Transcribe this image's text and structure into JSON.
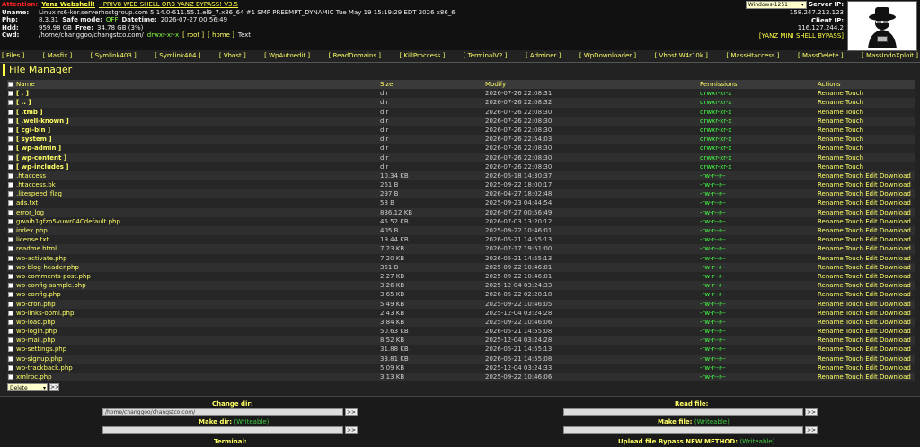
{
  "header": {
    "attention_label": "Attention:",
    "title": "Yanz Webshell!",
    "subtitle": "- PRIV8 WEB SHELL ORB YANZ BYPASS! V3.5",
    "uname_label": "Uname:",
    "uname_value": "Linux rs6-kor.serverhostgroup.com 5.14.0-611.55.1.el9_7.x86_64 #1 SMP PREEMPT_DYNAMIC Tue May 19 15:19:29 EDT 2026 x86_6",
    "php_label": "Php:",
    "php_version": "8.3.31",
    "safe_mode_label": "Safe mode:",
    "safe_mode_value": "OFF",
    "datetime_label": "Datetime:",
    "datetime_value": "2026-07-27 00:56:49",
    "hdd_label": "Hdd:",
    "hdd_total": "959.98 GB",
    "hdd_free_label": "Free:",
    "hdd_free": "34.78 GB (3%)",
    "cwd_label": "Cwd:",
    "cwd_path": "/home/changgoo/changstco.com/",
    "cwd_perm": "drwxr-xr-x",
    "cwd_root": "[ root ]",
    "cwd_home": "[ home ]",
    "cwd_text": "Text",
    "os_select": "Windows-1251",
    "server_ip_label": "Server IP:",
    "server_ip": "158.247.212.123",
    "client_ip_label": "Client IP:",
    "client_ip": "116.127.244.2",
    "bypass_label": "[YANZ MINI SHELL BYPASS]"
  },
  "menu": [
    "[ Files ]",
    "[ Masfix ]",
    "[ Symlink403 ]",
    "[ Symlink404 ]",
    "[ Vhost ]",
    "[ WpAutoedit ]",
    "[ ReadDomains ]",
    "[ KillProccess ]",
    "[ TerminalV2 ]",
    "[ Adminer ]",
    "[ WpDownloader ]",
    "[ Vhost W4r10k ]",
    "[ MassHtaccess ]",
    "[ MassDelete ]",
    "[ MassIndoXploit ]"
  ],
  "file_manager": {
    "title": "File Manager",
    "columns": {
      "name": "Name",
      "size": "Size",
      "modify": "Modify",
      "permissions": "Permissions",
      "actions": "Actions"
    },
    "rows": [
      {
        "name": "[ . ]",
        "size": "dir",
        "modify": "2026-07-26 22:08:31",
        "perm": "drwxr-xr-x",
        "actions": "Rename Touch",
        "dir": true
      },
      {
        "name": "[ .. ]",
        "size": "dir",
        "modify": "2026-07-26 22:08:32",
        "perm": "drwxr-xr-x",
        "actions": "Rename Touch",
        "dir": true
      },
      {
        "name": "[ .tmb ]",
        "size": "dir",
        "modify": "2026-07-26 22:08:30",
        "perm": "drwxr-xr-x",
        "actions": "Rename Touch",
        "dir": true
      },
      {
        "name": "[ .well-known ]",
        "size": "dir",
        "modify": "2026-07-26 22:08:30",
        "perm": "drwxr-xr-x",
        "actions": "Rename Touch",
        "dir": true
      },
      {
        "name": "[ cgi-bin ]",
        "size": "dir",
        "modify": "2026-07-26 22:08:30",
        "perm": "drwxr-xr-x",
        "actions": "Rename Touch",
        "dir": true
      },
      {
        "name": "[ system ]",
        "size": "dir",
        "modify": "2026-07-26 22:54:03",
        "perm": "drwxr-xr-x",
        "actions": "Rename Touch",
        "dir": true
      },
      {
        "name": "[ wp-admin ]",
        "size": "dir",
        "modify": "2026-07-26 22:08:30",
        "perm": "drwxr-xr-x",
        "actions": "Rename Touch",
        "dir": true
      },
      {
        "name": "[ wp-content ]",
        "size": "dir",
        "modify": "2026-07-26 22:08:30",
        "perm": "drwxr-xr-x",
        "actions": "Rename Touch",
        "dir": true
      },
      {
        "name": "[ wp-includes ]",
        "size": "dir",
        "modify": "2026-07-26 22:08:30",
        "perm": "drwxr-xr-x",
        "actions": "Rename Touch",
        "dir": true
      },
      {
        "name": ".htaccess",
        "size": "10.34 KB",
        "modify": "2026-05-18 14:30:37",
        "perm": "-rw-r--r--",
        "actions": "Rename Touch Edit Download",
        "dir": false
      },
      {
        "name": ".htaccess.bk",
        "size": "261 B",
        "modify": "2025-09-22 18:00:17",
        "perm": "-rw-r--r--",
        "actions": "Rename Touch Edit Download",
        "dir": false
      },
      {
        "name": ".litespeed_flag",
        "size": "297 B",
        "modify": "2026-04-27 18:02:48",
        "perm": "-rw-r--r--",
        "actions": "Rename Touch Edit Download",
        "dir": false
      },
      {
        "name": "ads.txt",
        "size": "58 B",
        "modify": "2025-09-23 04:44:54",
        "perm": "-rw-r--r--",
        "actions": "Rename Touch Edit Download",
        "dir": false
      },
      {
        "name": "error_log",
        "size": "836.12 KB",
        "modify": "2026-07-27 00:56:49",
        "perm": "-rw-r--r--",
        "actions": "Rename Touch Edit Download",
        "dir": false
      },
      {
        "name": "gwaih1gfzp5vuwr04Cdefault.php",
        "size": "45.52 KB",
        "modify": "2026-07-03 13:20:12",
        "perm": "-rw-r--r--",
        "actions": "Rename Touch Edit Download",
        "dir": false
      },
      {
        "name": "index.php",
        "size": "405 B",
        "modify": "2025-09-22 10:46:01",
        "perm": "-rw-r--r--",
        "actions": "Rename Touch Edit Download",
        "dir": false
      },
      {
        "name": "license.txt",
        "size": "19.44 KB",
        "modify": "2026-05-21 14:55:13",
        "perm": "-rw-r--r--",
        "actions": "Rename Touch Edit Download",
        "dir": false
      },
      {
        "name": "readme.html",
        "size": "7.23 KB",
        "modify": "2026-07-17 19:51:00",
        "perm": "-rw-r--r--",
        "actions": "Rename Touch Edit Download",
        "dir": false
      },
      {
        "name": "wp-activate.php",
        "size": "7.20 KB",
        "modify": "2026-05-21 14:55:13",
        "perm": "-rw-r--r--",
        "actions": "Rename Touch Edit Download",
        "dir": false
      },
      {
        "name": "wp-blog-header.php",
        "size": "351 B",
        "modify": "2025-09-22 10:46:01",
        "perm": "-rw-r--r--",
        "actions": "Rename Touch Edit Download",
        "dir": false
      },
      {
        "name": "wp-comments-post.php",
        "size": "2.27 KB",
        "modify": "2025-09-22 10:46:01",
        "perm": "-rw-r--r--",
        "actions": "Rename Touch Edit Download",
        "dir": false
      },
      {
        "name": "wp-config-sample.php",
        "size": "3.26 KB",
        "modify": "2025-12-04 03:24:33",
        "perm": "-rw-r--r--",
        "actions": "Rename Touch Edit Download",
        "dir": false
      },
      {
        "name": "wp-config.php",
        "size": "3.65 KB",
        "modify": "2026-05-22 02:28:18",
        "perm": "-rw-r--r--",
        "actions": "Rename Touch Edit Download",
        "dir": false
      },
      {
        "name": "wp-cron.php",
        "size": "5.49 KB",
        "modify": "2025-09-22 10:46:05",
        "perm": "-rw-r--r--",
        "actions": "Rename Touch Edit Download",
        "dir": false
      },
      {
        "name": "wp-links-opml.php",
        "size": "2.43 KB",
        "modify": "2025-12-04 03:24:28",
        "perm": "-rw-r--r--",
        "actions": "Rename Touch Edit Download",
        "dir": false
      },
      {
        "name": "wp-load.php",
        "size": "3.84 KB",
        "modify": "2025-09-22 10:46:06",
        "perm": "-rw-r--r--",
        "actions": "Rename Touch Edit Download",
        "dir": false
      },
      {
        "name": "wp-login.php",
        "size": "50.63 KB",
        "modify": "2026-05-21 14:55:08",
        "perm": "-rw-r--r--",
        "actions": "Rename Touch Edit Download",
        "dir": false
      },
      {
        "name": "wp-mail.php",
        "size": "8.52 KB",
        "modify": "2025-12-04 03:24:28",
        "perm": "-rw-r--r--",
        "actions": "Rename Touch Edit Download",
        "dir": false
      },
      {
        "name": "wp-settings.php",
        "size": "31.88 KB",
        "modify": "2026-05-21 14:55:13",
        "perm": "-rw-r--r--",
        "actions": "Rename Touch Edit Download",
        "dir": false
      },
      {
        "name": "wp-signup.php",
        "size": "33.81 KB",
        "modify": "2026-05-21 14:55:08",
        "perm": "-rw-r--r--",
        "actions": "Rename Touch Edit Download",
        "dir": false
      },
      {
        "name": "wp-trackback.php",
        "size": "5.09 KB",
        "modify": "2025-12-04 03:24:33",
        "perm": "-rw-r--r--",
        "actions": "Rename Touch Edit Download",
        "dir": false
      },
      {
        "name": "xmlrpc.php",
        "size": "3.13 KB",
        "modify": "2025-09-22 10:46:06",
        "perm": "-rw-r--r--",
        "actions": "Rename Touch Edit Download",
        "dir": false
      }
    ],
    "bulk_select": "Delete",
    "bulk_go": ">>"
  },
  "bottom": {
    "change_dir_label": "Change dir:",
    "change_dir_value": "/home/changgoo/changstco.com/",
    "read_file_label": "Read file:",
    "make_dir_label": "Make dir:",
    "make_dir_note": "(Writeable)",
    "make_file_label": "Make file:",
    "make_file_note": "(Writeable)",
    "terminal_label": "Terminal:",
    "upload_label": "Upload file Bypass NEW METHOD:",
    "upload_note": "(Writeable)",
    "go": ">>"
  }
}
